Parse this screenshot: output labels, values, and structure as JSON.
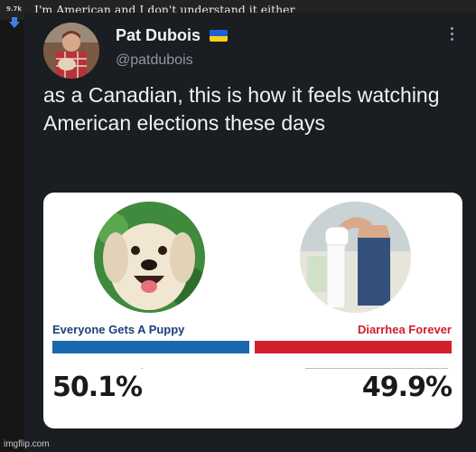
{
  "post": {
    "score": "9.7k",
    "title": "I'm American and I don't understand it either"
  },
  "tweet": {
    "display_name": "Pat Dubois",
    "handle": "@patdubois",
    "text": "as a Canadian, this is how it feels watching American elections these days"
  },
  "poll": {
    "left_label": "Everyone Gets A Puppy",
    "right_label": "Diarrhea Forever",
    "left_percent_text": "50.1%",
    "right_percent_text": "49.9%",
    "left_value": 50.1,
    "right_value": 49.9,
    "left_color": "#1a68ae",
    "right_color": "#d4202b"
  },
  "colors": {
    "background": "#161617",
    "card": "#1a1d22",
    "handle": "#8e9aa6"
  },
  "icons": {
    "downvote": "downvote-arrow-icon",
    "flag": "ukraine-flag-icon",
    "more": "more-options-icon"
  },
  "watermark": "imgflip.com"
}
